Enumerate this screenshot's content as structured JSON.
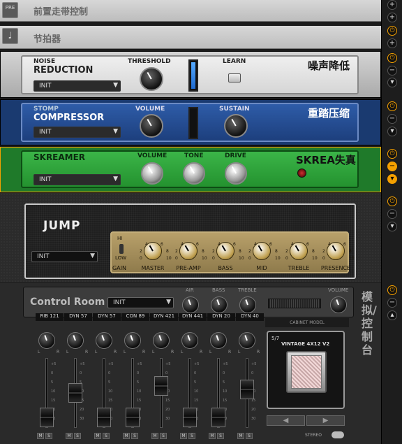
{
  "strips": [
    {
      "label": "前置走带控制",
      "icon": "PRE"
    },
    {
      "label": "节拍器",
      "icon": "metronome-icon"
    }
  ],
  "noise": {
    "top": "NOISE",
    "title": "REDUCTION",
    "preset": "INIT",
    "threshold": "THRESHOLD",
    "learn": "LEARN",
    "cn": "噪声降低",
    "meter_level": 0.9
  },
  "comp": {
    "top": "STOMP",
    "title": "COMPRESSOR",
    "preset": "INIT",
    "volume": "VOLUME",
    "sustain": "SUSTAIN",
    "cn": "重踏压缩",
    "meter_level": 0.0
  },
  "skreamer": {
    "title": "SKREAMER",
    "preset": "INIT",
    "volume": "VOLUME",
    "tone": "TONE",
    "drive": "DRIVE",
    "cn": "SKREA失真"
  },
  "amp": {
    "name": "JUMP",
    "preset": "INIT",
    "hi": "HI",
    "low": "LOW",
    "knobs": [
      "GAIN",
      "MASTER",
      "PRE-AMP",
      "BASS",
      "MID",
      "TREBLE",
      "PRESENCE"
    ],
    "scale": [
      "4",
      "6",
      "2",
      "8",
      "0",
      "10"
    ]
  },
  "control": {
    "title": "Control Room",
    "preset": "INIT",
    "air": "AIR",
    "bass": "BASS",
    "treble": "TREBLE",
    "volume": "VOLUME",
    "cn": "模拟/控制台",
    "channels": [
      {
        "name": "RIB 121",
        "fader": 0.15
      },
      {
        "name": "DYN 57",
        "fader": 0.5
      },
      {
        "name": "DYN 57",
        "fader": 0.15
      },
      {
        "name": "CON 89",
        "fader": 0.15
      },
      {
        "name": "DYN 421",
        "fader": 0.6
      },
      {
        "name": "DYN 441",
        "fader": 0.15
      },
      {
        "name": "DYN 20",
        "fader": 0.15
      },
      {
        "name": "DYN 40",
        "fader": 0.55
      }
    ],
    "lr": [
      "L",
      "R"
    ],
    "m": "M",
    "s": "S",
    "fader_scale": [
      "+5",
      "0",
      "5",
      "10",
      "15",
      "20",
      "30"
    ],
    "cabinet": {
      "header": "CABINET MODEL",
      "counter": "5/7",
      "name": "VINTAGE 4X12 V2",
      "stereo": "STEREO"
    }
  }
}
